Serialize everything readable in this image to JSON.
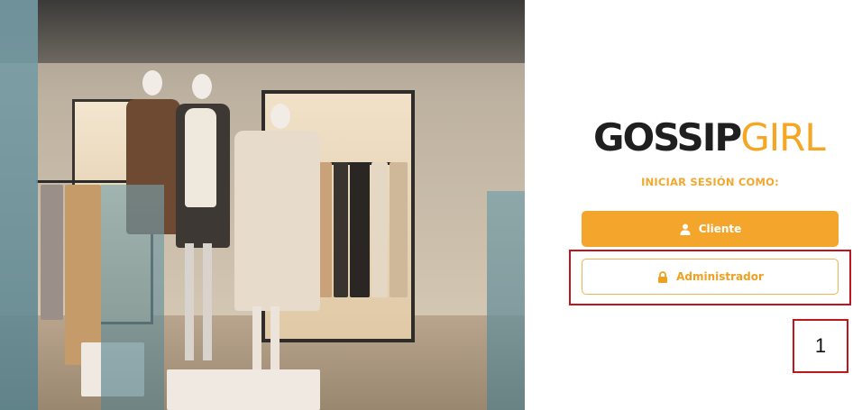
{
  "logo": {
    "part1": "GOSSIP",
    "part2": "GIRL"
  },
  "login": {
    "subtitle": "INICIAR SESIÓN COMO:",
    "cliente_label": "Cliente",
    "admin_label": "Administrador"
  },
  "annotation": {
    "label": "1"
  },
  "colors": {
    "accent": "#f4a52b",
    "highlight": "#c0141e",
    "logo_dark": "#1f1f1f"
  },
  "icons": {
    "cliente": "user-icon",
    "admin": "lock-icon"
  }
}
